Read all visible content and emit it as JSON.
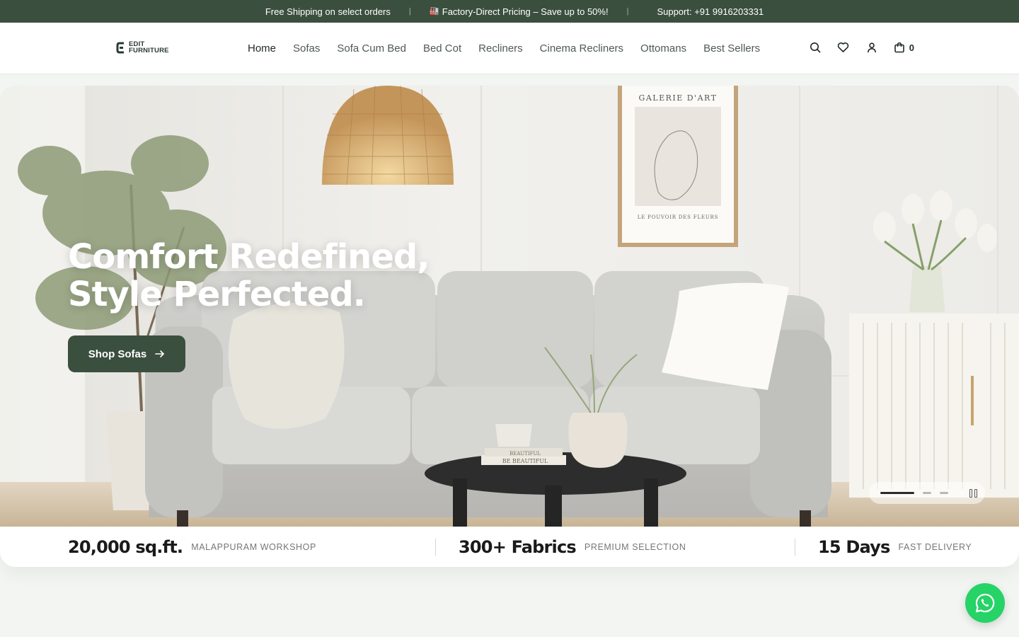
{
  "announcement": {
    "items": [
      {
        "icon": "delivery-truck-icon",
        "glyph": "",
        "text": "Free Shipping on select orders"
      },
      {
        "icon": "factory-icon",
        "glyph": "🏭",
        "text": "Factory-Direct Pricing – Save up to 50%!"
      },
      {
        "icon": "phone-icon",
        "glyph": "",
        "text": "Support: +91 9916203331"
      }
    ],
    "separator": "|"
  },
  "logo": {
    "line1": "EDIT",
    "line2": "FURNITURE"
  },
  "nav": {
    "items": [
      {
        "label": "Home",
        "active": true
      },
      {
        "label": "Sofas"
      },
      {
        "label": "Sofa Cum Bed"
      },
      {
        "label": "Bed Cot"
      },
      {
        "label": "Recliners"
      },
      {
        "label": "Cinema Recliners"
      },
      {
        "label": "Ottomans"
      },
      {
        "label": "Best Sellers"
      }
    ]
  },
  "header_icons": [
    "search-icon",
    "wishlist-heart-icon",
    "account-user-icon",
    "cart-bag-icon"
  ],
  "cart": {
    "count": "0"
  },
  "hero": {
    "title_line1": "Comfort Redefined,",
    "title_line2": "Style Perfected.",
    "cta_label": "Shop Sofas",
    "art_title": "GALERIE D'ART",
    "art_caption": "LE POUVOIR DES FLEURS",
    "book_titles": [
      "BE BEAUTIFUL",
      "BEAUTIFUL"
    ],
    "slides_total": 3,
    "slide_active": 1
  },
  "stats": [
    {
      "value": "20,000 sq.ft.",
      "label": "MALAPPURAM WORKSHOP"
    },
    {
      "value": "300+ Fabrics",
      "label": "PREMIUM SELECTION"
    },
    {
      "value": "15 Days",
      "label": "FAST DELIVERY"
    }
  ],
  "colors": {
    "brand_green": "#3b4f3f",
    "whatsapp": "#25d366",
    "page_bg": "#f2f5f1"
  }
}
